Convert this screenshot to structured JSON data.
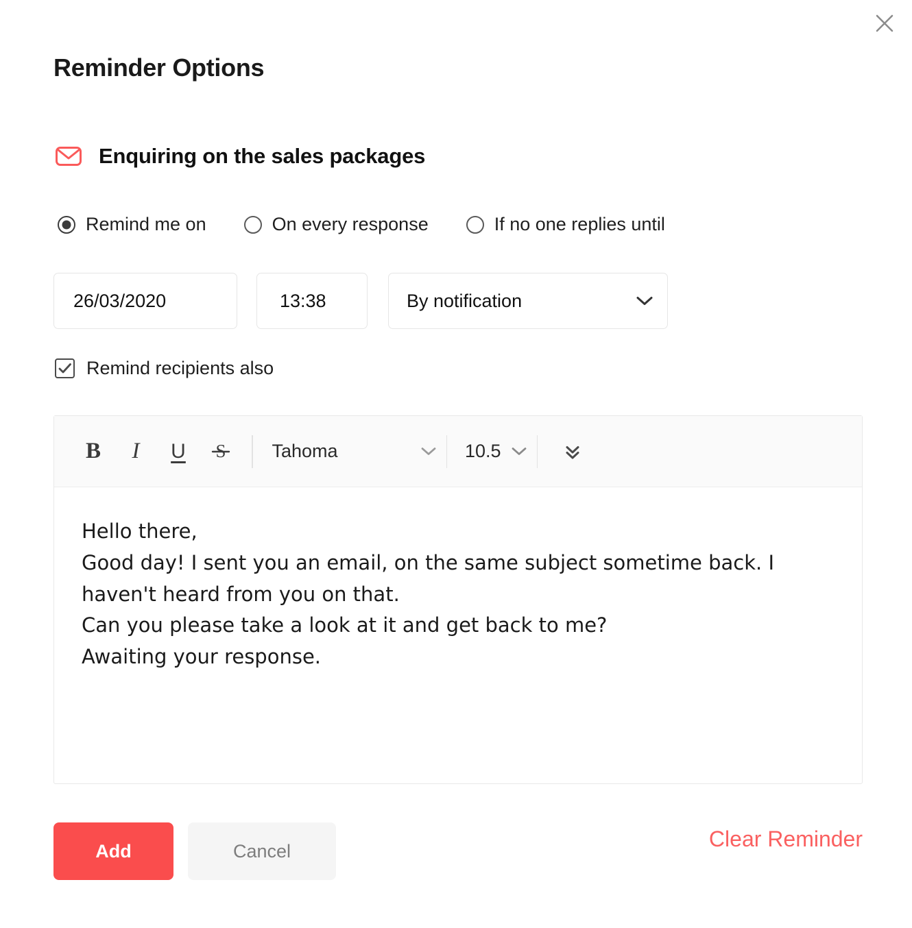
{
  "dialog": {
    "title": "Reminder Options",
    "close_icon": "close-icon"
  },
  "subject": {
    "icon": "envelope-icon",
    "text": "Enquiring on the sales packages"
  },
  "reminder_mode": {
    "options": [
      {
        "label": "Remind me on",
        "selected": true
      },
      {
        "label": "On every response",
        "selected": false
      },
      {
        "label": "If no one replies until",
        "selected": false
      }
    ]
  },
  "schedule": {
    "date_value": "26/03/2020",
    "time_value": "13:38",
    "method_value": "By notification",
    "method_chevron_icon": "chevron-down-icon"
  },
  "remind_recipients": {
    "label": "Remind recipients also",
    "checked": true
  },
  "editor": {
    "toolbar": {
      "bold_label": "B",
      "italic_label": "I",
      "underline_label": "U",
      "strikethrough_label": "S",
      "font_family_value": "Tahoma",
      "font_size_value": "10.5",
      "font_chevron_icon": "chevron-down-icon",
      "size_chevron_icon": "chevron-down-icon",
      "more_icon": "double-chevron-down-icon"
    },
    "body_text": "Hello there,\nGood day! I sent you an email, on the same subject sometime back. I haven't heard from you on that.\nCan you please take a look at it and get back to me?\nAwaiting your response."
  },
  "footer": {
    "add_label": "Add",
    "cancel_label": "Cancel",
    "clear_label": "Clear Reminder"
  },
  "colors": {
    "accent": "#fa4d4d",
    "clear_link": "#fa6060",
    "envelope": "#fa5a5a"
  }
}
